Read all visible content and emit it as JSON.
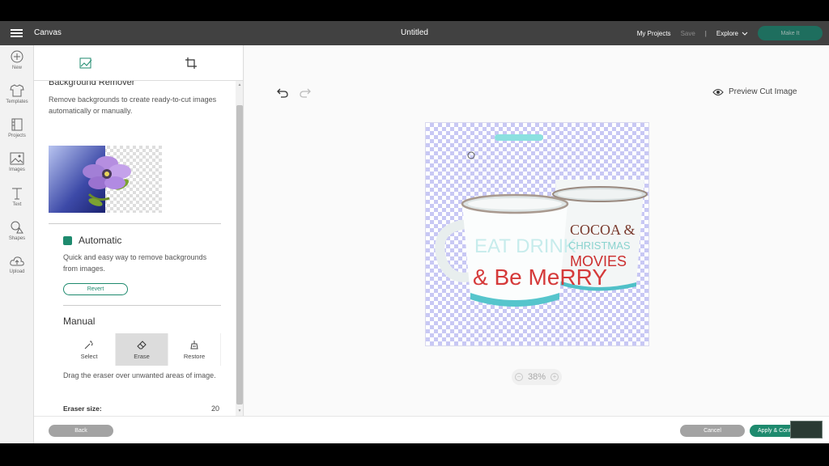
{
  "topbar": {
    "app_name": "Canvas",
    "document_title": "Untitled",
    "my_projects": "My Projects",
    "save": "Save",
    "separator": "|",
    "explore": "Explore",
    "make_it": "Make It"
  },
  "rail": {
    "items": [
      {
        "label": "New",
        "icon": "plus-circle-icon"
      },
      {
        "label": "Templates",
        "icon": "shirt-icon"
      },
      {
        "label": "Projects",
        "icon": "notebook-icon"
      },
      {
        "label": "Images",
        "icon": "image-icon"
      },
      {
        "label": "Text",
        "icon": "text-icon"
      },
      {
        "label": "Shapes",
        "icon": "shapes-icon"
      },
      {
        "label": "Upload",
        "icon": "cloud-upload-icon"
      }
    ]
  },
  "panel": {
    "section_title": "Background Remover",
    "section_desc": "Remove backgrounds to create ready-to-cut images automatically or manually.",
    "automatic_title": "Automatic",
    "automatic_desc": "Quick and easy way to remove backgrounds from images.",
    "revert_label": "Revert",
    "manual_title": "Manual",
    "tools": [
      {
        "label": "Select",
        "icon": "magic-wand-icon",
        "active": false
      },
      {
        "label": "Erase",
        "icon": "eraser-icon",
        "active": true
      },
      {
        "label": "Restore",
        "icon": "restore-brush-icon",
        "active": false
      }
    ],
    "manual_desc": "Drag the eraser over unwanted areas of image.",
    "eraser_label": "Eraser size:",
    "eraser_value": "20"
  },
  "canvas": {
    "preview_label": "Preview Cut Image",
    "zoom": "38%",
    "mug_left_text": [
      "EAT DRINK",
      "& Be MeRRY"
    ],
    "mug_right_text": [
      "COCOA &",
      "CHRISTMAS",
      "MOVIES"
    ]
  },
  "bottom": {
    "back": "Back",
    "cancel": "Cancel",
    "apply": "Apply & Continue"
  },
  "colors": {
    "accent": "#1e8a6e",
    "topbar": "#414141",
    "checker": "#c8c8f4"
  }
}
